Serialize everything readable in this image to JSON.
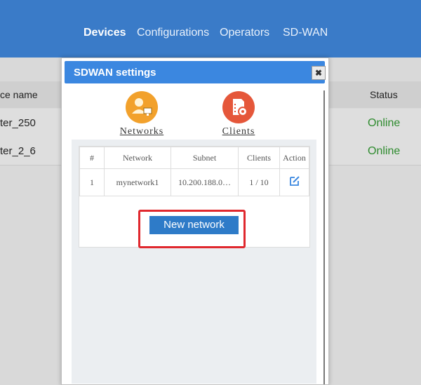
{
  "nav": {
    "items": [
      "Devices",
      "Configurations",
      "Operators",
      "SD-WAN"
    ],
    "active": "Devices"
  },
  "background_table": {
    "col_name": "ce name",
    "col_status": "Status",
    "rows": [
      {
        "name": "ter_250",
        "status": "Online"
      },
      {
        "name": "ter_2_6",
        "status": "Online"
      }
    ]
  },
  "modal": {
    "title": "SDWAN settings",
    "close_symbol": "✖",
    "tabs": [
      {
        "label": "Networks",
        "icon": "networks-icon",
        "color": "#f2a12c"
      },
      {
        "label": "Clients",
        "icon": "clients-icon",
        "color": "#e5573a"
      }
    ],
    "table": {
      "headers": [
        "#",
        "Network",
        "Subnet",
        "Clients",
        "Action"
      ],
      "rows": [
        {
          "index": "1",
          "network": "mynetwork1",
          "subnet": "10.200.188.0…",
          "clients": "1 / 10"
        }
      ]
    },
    "new_button": "New network"
  },
  "colors": {
    "header": "#3a7bc8",
    "modal_header": "#3b87e0",
    "online": "#2e8b2e",
    "highlight": "#e0282e"
  }
}
